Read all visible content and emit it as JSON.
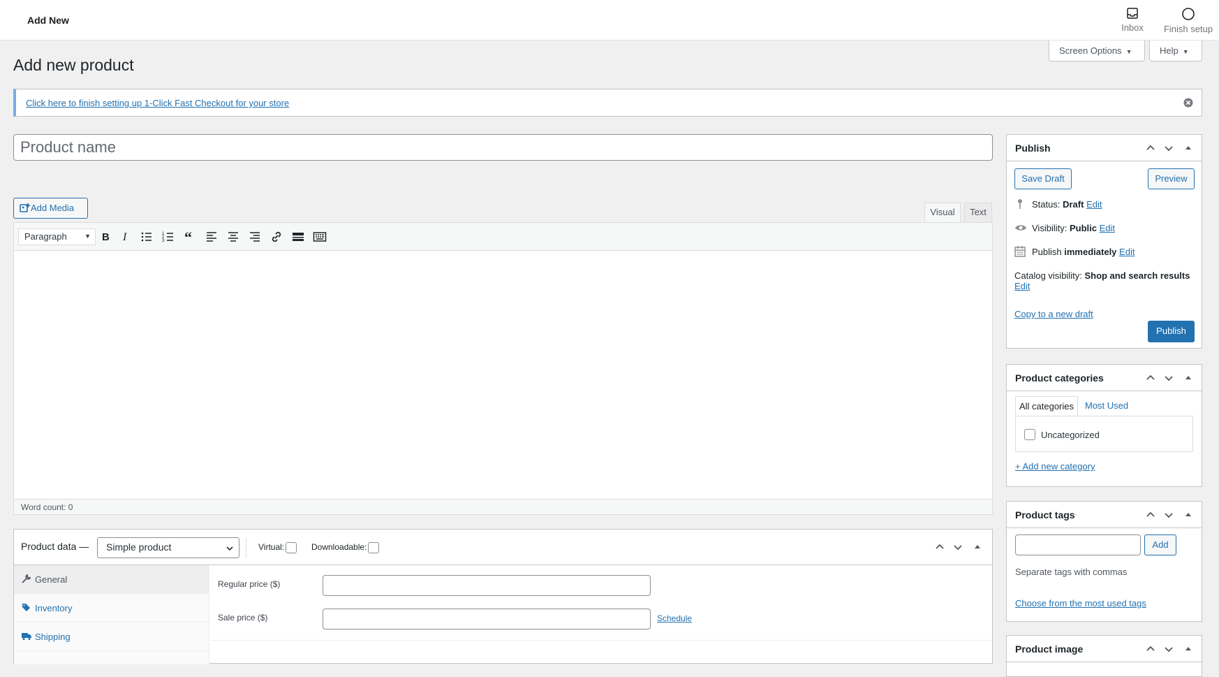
{
  "topbar": {
    "title": "Add New",
    "inbox_label": "Inbox",
    "finish_label": "Finish setup"
  },
  "screen_options_label": "Screen Options",
  "help_label": "Help",
  "page_title": "Add new product",
  "notice": {
    "link_text": "Click here to finish setting up 1-Click Fast Checkout for your store"
  },
  "product_name_placeholder": "Product name",
  "editor": {
    "add_media_label": "Add Media",
    "tab_visual": "Visual",
    "tab_text": "Text",
    "format_value": "Paragraph",
    "word_count": "Word count: 0"
  },
  "product_data": {
    "title": "Product data —",
    "type_value": "Simple product",
    "virtual_label": "Virtual:",
    "downloadable_label": "Downloadable:",
    "nav": [
      "General",
      "Inventory",
      "Shipping"
    ],
    "regular_price_label": "Regular price ($)",
    "sale_price_label": "Sale price ($)",
    "schedule_label": "Schedule"
  },
  "publish": {
    "title": "Publish",
    "save_draft": "Save Draft",
    "preview": "Preview",
    "status_label": "Status:",
    "status_value": "Draft",
    "visibility_label": "Visibility:",
    "visibility_value": "Public",
    "publish_label": "Publish",
    "publish_value": "immediately",
    "edit": "Edit",
    "catalog_label": "Catalog visibility:",
    "catalog_value": "Shop and search results",
    "copy_draft": "Copy to a new draft",
    "publish_button": "Publish"
  },
  "categories": {
    "title": "Product categories",
    "tab_all": "All categories",
    "tab_most": "Most Used",
    "items": [
      "Uncategorized"
    ],
    "add_new": "+ Add new category"
  },
  "tags": {
    "title": "Product tags",
    "add_label": "Add",
    "help": "Separate tags with commas",
    "choose_most": "Choose from the most used tags"
  },
  "product_image": {
    "title": "Product image"
  },
  "colors": {
    "accent": "#2271b1",
    "notice_border": "#72aee6"
  }
}
